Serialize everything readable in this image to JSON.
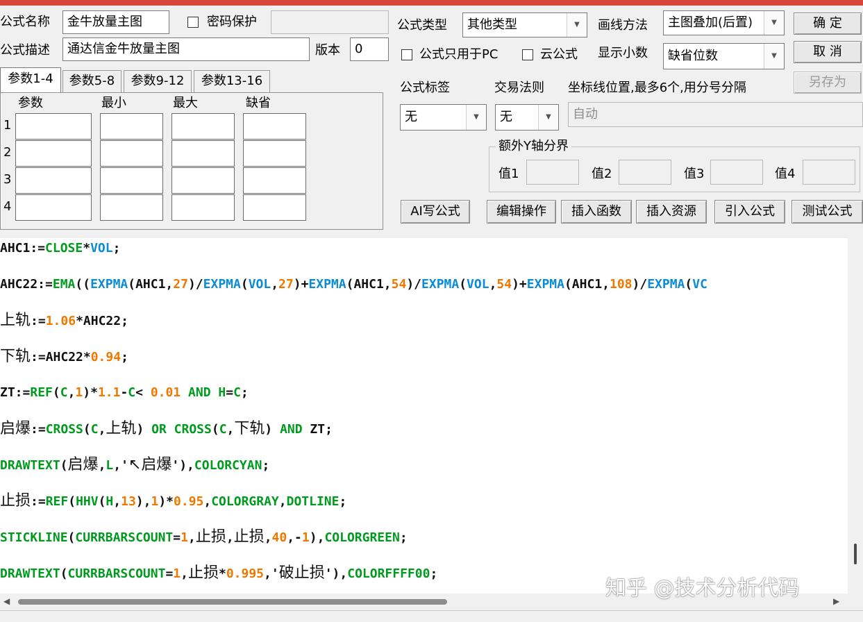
{
  "header": {
    "formula_name_label": "公式名称",
    "formula_name_value": "金牛放量主图",
    "password_label": "密码保护",
    "formula_desc_label": "公式描述",
    "formula_desc_value": "通达信金牛放量主图",
    "version_label": "版本",
    "version_value": "0",
    "formula_type_label": "公式类型",
    "formula_type_value": "其他类型",
    "draw_method_label": "画线方法",
    "draw_method_value": "主图叠加(后置)",
    "pc_only_label": "公式只用于PC",
    "cloud_label": "云公式",
    "decimals_label": "显示小数",
    "decimals_value": "缺省位数",
    "confirm_label": "确  定",
    "cancel_label": "取  消",
    "save_as_label": "另存为"
  },
  "params": {
    "tabs": [
      "参数1-4",
      "参数5-8",
      "参数9-12",
      "参数13-16"
    ],
    "columns": [
      "参数",
      "最小",
      "最大",
      "缺省"
    ],
    "rows": [
      "1",
      "2",
      "3",
      "4"
    ]
  },
  "settings": {
    "tag_label": "公式标签",
    "tag_value": "无",
    "trade_rule_label": "交易法则",
    "trade_rule_value": "无",
    "coord_label": "坐标线位置,最多6个,用分号分隔",
    "coord_placeholder": "自动",
    "y_axis_group": "额外Y轴分界",
    "val_labels": [
      "值1",
      "值2",
      "值3",
      "值4"
    ]
  },
  "actions": [
    "AI写公式",
    "编辑操作",
    "插入函数",
    "插入资源",
    "引入公式",
    "测试公式"
  ],
  "code_lines": [
    [
      [
        "AHC1:=",
        "black"
      ],
      [
        "CLOSE",
        "green"
      ],
      [
        "*",
        "black"
      ],
      [
        "VOL",
        "blue"
      ],
      [
        ";",
        "black"
      ]
    ],
    [
      [
        "AHC22:=",
        "black"
      ],
      [
        "EMA",
        "green"
      ],
      [
        "((",
        "black"
      ],
      [
        "EXPMA",
        "blue"
      ],
      [
        "(AHC1,",
        "black"
      ],
      [
        "27",
        "orange"
      ],
      [
        ")/",
        "black"
      ],
      [
        "EXPMA",
        "blue"
      ],
      [
        "(",
        "black"
      ],
      [
        "VOL",
        "blue"
      ],
      [
        ",",
        "black"
      ],
      [
        "27",
        "orange"
      ],
      [
        ")+",
        "black"
      ],
      [
        "EXPMA",
        "blue"
      ],
      [
        "(AHC1,",
        "black"
      ],
      [
        "54",
        "orange"
      ],
      [
        ")/",
        "black"
      ],
      [
        "EXPMA",
        "blue"
      ],
      [
        "(",
        "black"
      ],
      [
        "VOL",
        "blue"
      ],
      [
        ",",
        "black"
      ],
      [
        "54",
        "orange"
      ],
      [
        ")+",
        "black"
      ],
      [
        "EXPMA",
        "blue"
      ],
      [
        "(AHC1,",
        "black"
      ],
      [
        "108",
        "orange"
      ],
      [
        ")/",
        "black"
      ],
      [
        "EXPMA",
        "blue"
      ],
      [
        "(",
        "black"
      ],
      [
        "VC",
        "blue"
      ]
    ],
    [
      [
        "上轨",
        "black",
        "cjk"
      ],
      [
        ":=",
        "black"
      ],
      [
        "1.06",
        "orange"
      ],
      [
        "*AHC22;",
        "black"
      ]
    ],
    [
      [
        "下轨",
        "black",
        "cjk"
      ],
      [
        ":=AHC22*",
        "black"
      ],
      [
        "0.94",
        "orange"
      ],
      [
        ";",
        "black"
      ]
    ],
    [
      [
        "ZT:=",
        "black"
      ],
      [
        "REF",
        "green"
      ],
      [
        "(",
        "black"
      ],
      [
        "C",
        "green"
      ],
      [
        ",",
        "black"
      ],
      [
        "1",
        "orange"
      ],
      [
        ")*",
        "black"
      ],
      [
        "1.1",
        "orange"
      ],
      [
        "-",
        "black"
      ],
      [
        "C",
        "green"
      ],
      [
        "< ",
        "black"
      ],
      [
        "0.01",
        "orange"
      ],
      [
        " ",
        "black"
      ],
      [
        "AND",
        "green"
      ],
      [
        " ",
        "black"
      ],
      [
        "H",
        "green"
      ],
      [
        "=",
        "black"
      ],
      [
        "C",
        "green"
      ],
      [
        ";",
        "black"
      ]
    ],
    [
      [
        "启爆",
        "black",
        "cjk"
      ],
      [
        ":=",
        "black"
      ],
      [
        "CROSS",
        "green"
      ],
      [
        "(",
        "black"
      ],
      [
        "C",
        "green"
      ],
      [
        ",",
        "black"
      ],
      [
        "上轨",
        "black",
        "cjk"
      ],
      [
        ") ",
        "black"
      ],
      [
        "OR",
        "green"
      ],
      [
        " ",
        "black"
      ],
      [
        "CROSS",
        "green"
      ],
      [
        "(",
        "black"
      ],
      [
        "C",
        "green"
      ],
      [
        ",",
        "black"
      ],
      [
        "下轨",
        "black",
        "cjk"
      ],
      [
        ") ",
        "black"
      ],
      [
        "AND",
        "green"
      ],
      [
        " ZT;",
        "black"
      ]
    ],
    [
      [
        "DRAWTEXT",
        "green"
      ],
      [
        "(",
        "black"
      ],
      [
        "启爆",
        "black",
        "cjk"
      ],
      [
        ",",
        "black"
      ],
      [
        "L",
        "green"
      ],
      [
        ",'",
        "black"
      ],
      [
        "↖启爆",
        "black",
        "cjk"
      ],
      [
        "'),",
        "black"
      ],
      [
        "COLORCYAN",
        "green"
      ],
      [
        ";",
        "black"
      ]
    ],
    [
      [
        "止损",
        "black",
        "cjk"
      ],
      [
        ":=",
        "black"
      ],
      [
        "REF",
        "green"
      ],
      [
        "(",
        "black"
      ],
      [
        "HHV",
        "green"
      ],
      [
        "(",
        "black"
      ],
      [
        "H",
        "green"
      ],
      [
        ",",
        "black"
      ],
      [
        "13",
        "orange"
      ],
      [
        "),",
        "black"
      ],
      [
        "1",
        "orange"
      ],
      [
        ")*",
        "black"
      ],
      [
        "0.95",
        "orange"
      ],
      [
        ",",
        "black"
      ],
      [
        "COLORGRAY",
        "green"
      ],
      [
        ",",
        "black"
      ],
      [
        "DOTLINE",
        "green"
      ],
      [
        ";",
        "black"
      ]
    ],
    [
      [
        "STICKLINE",
        "green"
      ],
      [
        "(",
        "black"
      ],
      [
        "CURRBARSCOUNT",
        "green"
      ],
      [
        "=",
        "black"
      ],
      [
        "1",
        "orange"
      ],
      [
        ",",
        "black"
      ],
      [
        "止损",
        "black",
        "cjk"
      ],
      [
        ",",
        "black"
      ],
      [
        "止损",
        "black",
        "cjk"
      ],
      [
        ",",
        "black"
      ],
      [
        "40",
        "orange"
      ],
      [
        ",-",
        "black"
      ],
      [
        "1",
        "orange"
      ],
      [
        "),",
        "black"
      ],
      [
        "COLORGREEN",
        "green"
      ],
      [
        ";",
        "black"
      ]
    ],
    [
      [
        "DRAWTEXT",
        "green"
      ],
      [
        "(",
        "black"
      ],
      [
        "CURRBARSCOUNT",
        "green"
      ],
      [
        "=",
        "black"
      ],
      [
        "1",
        "orange"
      ],
      [
        ",",
        "black"
      ],
      [
        "止损",
        "black",
        "cjk"
      ],
      [
        "*",
        "black"
      ],
      [
        "0.995",
        "orange"
      ],
      [
        ",'",
        "black"
      ],
      [
        "破止损",
        "black",
        "cjk"
      ],
      [
        "'),",
        "black"
      ],
      [
        "COLORFFFF00",
        "green"
      ],
      [
        ";",
        "black"
      ]
    ]
  ],
  "watermark": "知乎 @技术分析代码"
}
